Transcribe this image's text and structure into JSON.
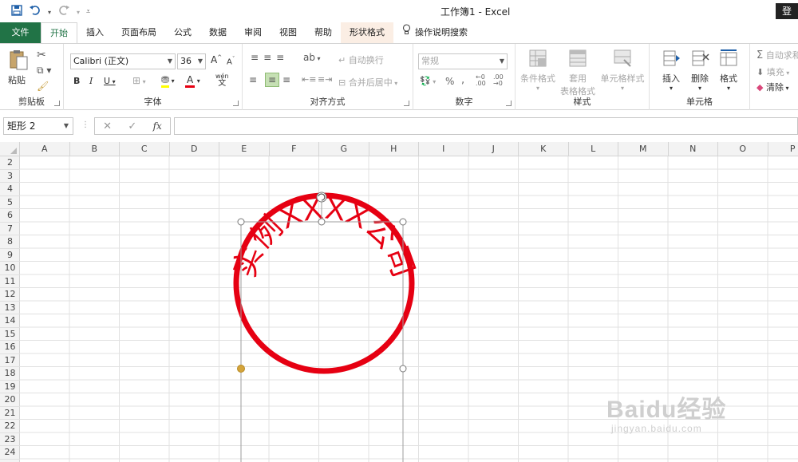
{
  "window": {
    "title": "工作簿1  -  Excel",
    "login_label": "登"
  },
  "tabs": [
    {
      "label": "文件"
    },
    {
      "label": "开始"
    },
    {
      "label": "插入"
    },
    {
      "label": "页面布局"
    },
    {
      "label": "公式"
    },
    {
      "label": "数据"
    },
    {
      "label": "审阅"
    },
    {
      "label": "视图"
    },
    {
      "label": "帮助"
    },
    {
      "label": "形状格式"
    },
    {
      "label": "操作说明搜索"
    }
  ],
  "ribbon": {
    "clipboard": {
      "label": "剪贴板",
      "paste": "粘贴"
    },
    "font": {
      "label": "字体",
      "font_name": "Calibri (正文)",
      "font_size": "36",
      "bold": "B",
      "italic": "I",
      "underline": "U",
      "grow": "A",
      "shrink": "A",
      "color_a": "A",
      "phonetic": "wén"
    },
    "alignment": {
      "label": "对齐方式",
      "wrap": "自动换行",
      "merge": "合并后居中"
    },
    "number": {
      "label": "数字",
      "format": "常规",
      "percent": "%",
      "comma": ","
    },
    "styles": {
      "label": "样式",
      "conditional": "条件格式",
      "table_top": "套用",
      "table_bottom": "表格格式",
      "cell_styles": "单元格样式"
    },
    "cells": {
      "label": "单元格",
      "insert": "插入",
      "delete": "删除",
      "format": "格式"
    },
    "editing": {
      "autosum": "自动求和",
      "fill": "填充",
      "clear": "清除"
    }
  },
  "formula_bar": {
    "name_box": "矩形 2",
    "cancel": "✕",
    "enter": "✓",
    "fx": "fx",
    "value": ""
  },
  "sheet": {
    "columns": [
      "A",
      "B",
      "C",
      "D",
      "E",
      "F",
      "G",
      "H",
      "I",
      "J",
      "K",
      "L",
      "M",
      "N",
      "O",
      "P"
    ],
    "rows": [
      "2",
      "3",
      "4",
      "5",
      "6",
      "7",
      "8",
      "9",
      "10",
      "11",
      "12",
      "13",
      "14",
      "15",
      "16",
      "17",
      "18",
      "19",
      "20",
      "21",
      "22",
      "23",
      "24"
    ]
  },
  "seal": {
    "text": "实例XXXX公司",
    "color": "#e60012"
  },
  "watermark": {
    "brand": "Baidu经验",
    "url": "jingyan.baidu.com"
  },
  "colors": {
    "excel_green": "#217346",
    "shape_tab_bg": "#fbeee4"
  }
}
